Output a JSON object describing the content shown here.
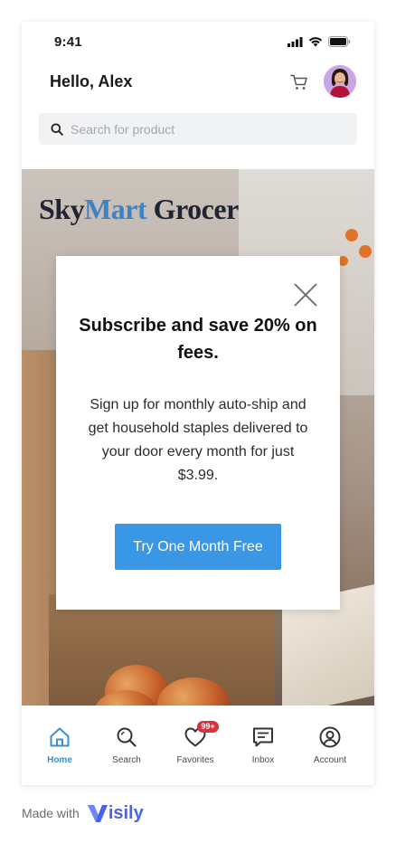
{
  "status_bar": {
    "time": "9:41"
  },
  "header": {
    "greeting": "Hello, Alex"
  },
  "search": {
    "placeholder": "Search for product"
  },
  "hero": {
    "brand_part1": "Sky",
    "brand_part2": "Mart",
    "brand_part3": " Grocer"
  },
  "modal": {
    "title": "Subscribe and save 20% on fees.",
    "body": "Sign up for monthly auto-ship and get household staples delivered to your door every month for just $3.99.",
    "cta_label": "Try One Month Free"
  },
  "tabs": [
    {
      "label": "Home",
      "icon": "home-icon",
      "active": true
    },
    {
      "label": "Search",
      "icon": "search-icon",
      "active": false
    },
    {
      "label": "Favorites",
      "icon": "heart-icon",
      "active": false,
      "badge": "99+"
    },
    {
      "label": "Inbox",
      "icon": "inbox-icon",
      "active": false
    },
    {
      "label": "Account",
      "icon": "account-icon",
      "active": false
    }
  ],
  "footer": {
    "made_with": "Made with",
    "brand": "isily"
  },
  "colors": {
    "accent": "#3a97e6",
    "active_tab": "#3a8fd6",
    "badge": "#d8323b",
    "brand_accent": "#3d82c4",
    "visily": "#4b62e8"
  }
}
